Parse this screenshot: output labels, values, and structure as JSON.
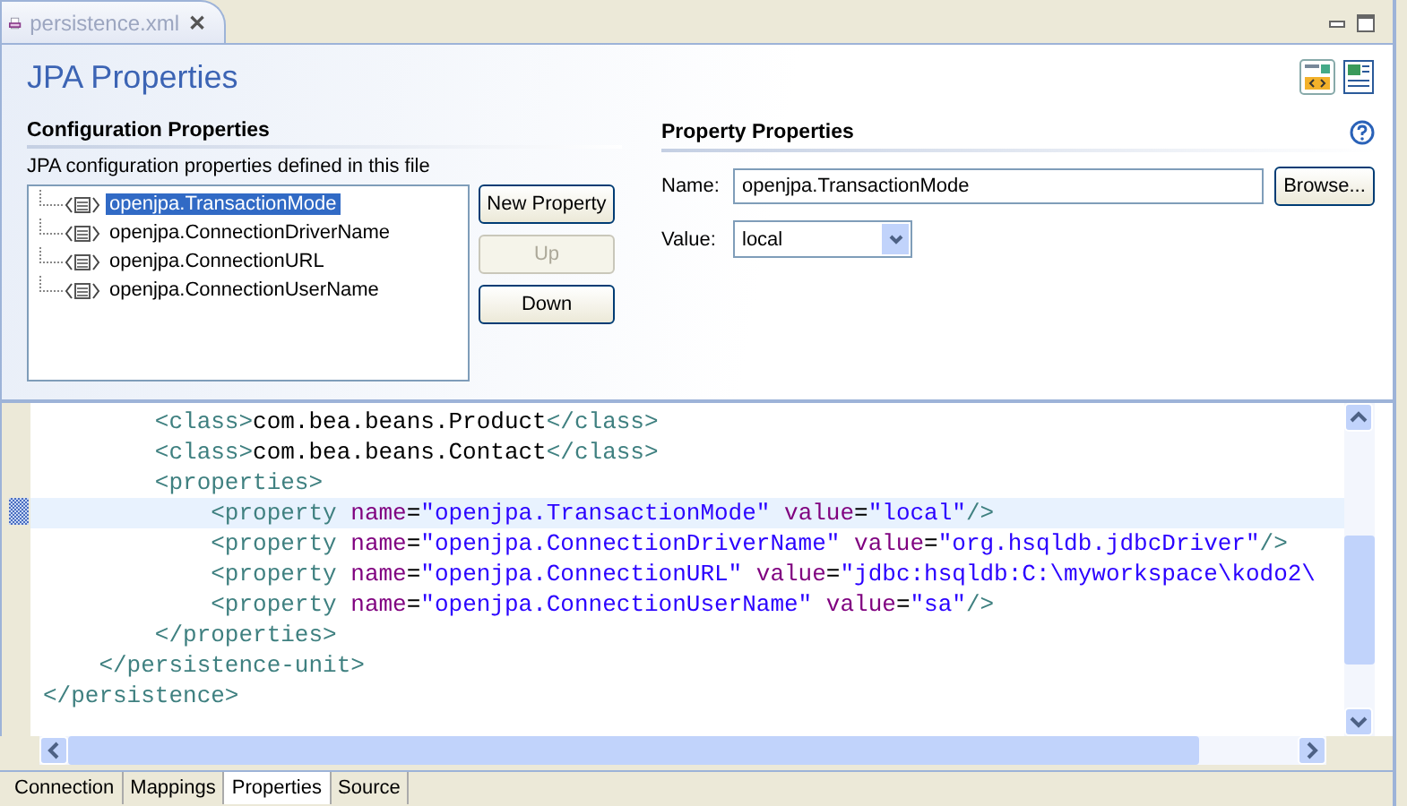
{
  "editor_tab": {
    "title": "persistence.xml",
    "close": "✕"
  },
  "form": {
    "title": "JPA Properties",
    "config": {
      "heading": "Configuration Properties",
      "description": "JPA configuration properties defined in this file",
      "items": [
        {
          "label": "openjpa.TransactionMode",
          "selected": true
        },
        {
          "label": "openjpa.ConnectionDriverName",
          "selected": false
        },
        {
          "label": "openjpa.ConnectionURL",
          "selected": false
        },
        {
          "label": "openjpa.ConnectionUserName",
          "selected": false
        }
      ],
      "buttons": [
        {
          "label": "New Property",
          "disabled": false
        },
        {
          "label": "Up",
          "disabled": true
        },
        {
          "label": "Down",
          "disabled": false
        }
      ]
    },
    "property": {
      "heading": "Property Properties",
      "name_label": "Name:",
      "name_value": "openjpa.TransactionMode",
      "browse": "Browse...",
      "value_label": "Value:",
      "value": "local"
    }
  },
  "source": {
    "lines": [
      {
        "current": false,
        "tokens": [
          {
            "kind": "tag",
            "text": "        <class>"
          },
          {
            "kind": "text",
            "text": "com.bea.beans.Product"
          },
          {
            "kind": "tag",
            "text": "</class>"
          }
        ]
      },
      {
        "current": false,
        "tokens": [
          {
            "kind": "tag",
            "text": "        <class>"
          },
          {
            "kind": "text",
            "text": "com.bea.beans.Contact"
          },
          {
            "kind": "tag",
            "text": "</class>"
          }
        ]
      },
      {
        "current": false,
        "tokens": [
          {
            "kind": "tag",
            "text": "        <properties>"
          }
        ]
      },
      {
        "current": true,
        "tokens": [
          {
            "kind": "tag",
            "text": "            <property "
          },
          {
            "kind": "attr",
            "text": "name"
          },
          {
            "kind": "text",
            "text": "="
          },
          {
            "kind": "str",
            "text": "\"openjpa.TransactionMode\" "
          },
          {
            "kind": "attr",
            "text": "value"
          },
          {
            "kind": "text",
            "text": "="
          },
          {
            "kind": "str",
            "text": "\"local\""
          },
          {
            "kind": "tag",
            "text": "/>"
          }
        ]
      },
      {
        "current": false,
        "tokens": [
          {
            "kind": "tag",
            "text": "            <property "
          },
          {
            "kind": "attr",
            "text": "name"
          },
          {
            "kind": "text",
            "text": "="
          },
          {
            "kind": "str",
            "text": "\"openjpa.ConnectionDriverName\" "
          },
          {
            "kind": "attr",
            "text": "value"
          },
          {
            "kind": "text",
            "text": "="
          },
          {
            "kind": "str",
            "text": "\"org.hsqldb.jdbcDriver\""
          },
          {
            "kind": "tag",
            "text": "/>"
          }
        ]
      },
      {
        "current": false,
        "tokens": [
          {
            "kind": "tag",
            "text": "            <property "
          },
          {
            "kind": "attr",
            "text": "name"
          },
          {
            "kind": "text",
            "text": "="
          },
          {
            "kind": "str",
            "text": "\"openjpa.ConnectionURL\" "
          },
          {
            "kind": "attr",
            "text": "value"
          },
          {
            "kind": "text",
            "text": "="
          },
          {
            "kind": "str",
            "text": "\"jdbc:hsqldb:C:\\myworkspace\\kodo2\\"
          }
        ]
      },
      {
        "current": false,
        "tokens": [
          {
            "kind": "tag",
            "text": "            <property "
          },
          {
            "kind": "attr",
            "text": "name"
          },
          {
            "kind": "text",
            "text": "="
          },
          {
            "kind": "str",
            "text": "\"openjpa.ConnectionUserName\" "
          },
          {
            "kind": "attr",
            "text": "value"
          },
          {
            "kind": "text",
            "text": "="
          },
          {
            "kind": "str",
            "text": "\"sa\""
          },
          {
            "kind": "tag",
            "text": "/>"
          }
        ]
      },
      {
        "current": false,
        "tokens": [
          {
            "kind": "tag",
            "text": "        </properties>"
          }
        ]
      },
      {
        "current": false,
        "tokens": [
          {
            "kind": "tag",
            "text": "    </persistence-unit>"
          }
        ]
      },
      {
        "current": false,
        "tokens": [
          {
            "kind": "tag",
            "text": "</persistence>"
          }
        ]
      }
    ]
  },
  "page_tabs": [
    {
      "label": "Connection",
      "selected": false
    },
    {
      "label": "Mappings",
      "selected": false
    },
    {
      "label": "Properties",
      "selected": true
    },
    {
      "label": "Source",
      "selected": false
    }
  ]
}
